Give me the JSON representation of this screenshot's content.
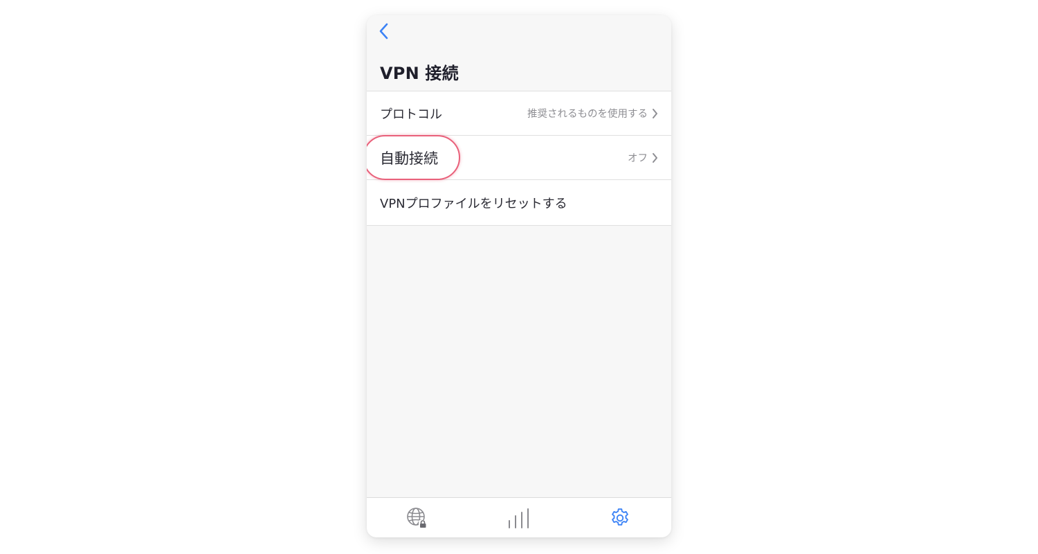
{
  "header": {
    "back_icon": "chevron-left-icon",
    "title": "VPN 接続"
  },
  "settings": {
    "rows": [
      {
        "label": "プロトコル",
        "value": "推奨されるものを使用する",
        "icon": "chevron-right-icon"
      },
      {
        "label": "自動接続",
        "value": "オフ",
        "icon": "chevron-right-icon",
        "highlighted": true
      },
      {
        "label": "VPNプロファイルをリセットする"
      }
    ]
  },
  "tabbar": {
    "tabs": [
      {
        "icon": "globe-lock-icon",
        "active": false
      },
      {
        "icon": "stats-bars-icon",
        "active": false
      },
      {
        "icon": "gear-icon",
        "active": true
      }
    ]
  },
  "colors": {
    "accent": "#3b82f6",
    "highlight": "#e9607a",
    "inactive_icon": "#8a8a8f",
    "background": "#f7f7f7"
  }
}
